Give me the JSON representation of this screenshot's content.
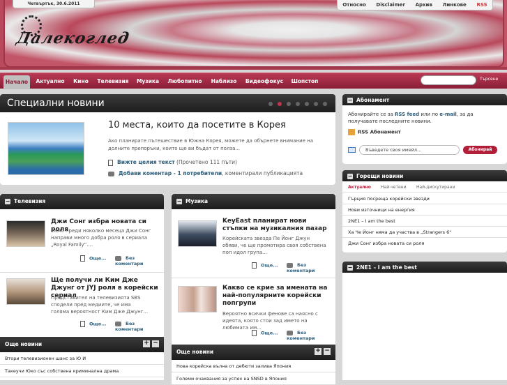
{
  "header": {
    "date": "Четвъртък, 30.6.2011",
    "logo": "Далекоглед",
    "top_links": [
      "Относно",
      "Disclaimer",
      "Архив",
      "Линкове",
      "RSS"
    ]
  },
  "nav": {
    "items": [
      "Начало",
      "Актуално",
      "Кино",
      "Телевизия",
      "Музика",
      "Любопитно",
      "Наблизо",
      "Видеофокус",
      "Шопстоп"
    ],
    "active": "Начало",
    "search_label": "Търсене"
  },
  "special": {
    "title": "Специални новини",
    "article_title": "10 места, които да посетите в Корея",
    "article_text": "Ако планирате пътешествие в Южна Корея, можете да обърнете внимание на долните препоръки, които ще ви бъдат от полза...",
    "read_more": "Вижте целия текст",
    "read_count": "(Прочетено 111 пъти)",
    "comment_add": "Добави коментар - 1 потребители",
    "comment_suffix": ", коментирали публикацията"
  },
  "tv": {
    "title": "Телевизия",
    "articles": [
      {
        "title": "Джи Сонг избра новата си роля",
        "text": "Само преди няколко месеца Джи Сонг направи много добра роля в сериала „Royal Family“....",
        "more": "Още...",
        "comments": "Без коментари"
      },
      {
        "title": "Ще получи ли Ким Дже Джунг от JYJ роля в корейски сериал",
        "text": "Представител на телевизията SBS сподели пред медиите, че има голяма вероятност Ким Дже Джунг...",
        "more": "Още...",
        "comments": "Без коментари"
      }
    ],
    "more_news_title": "Още новини",
    "more_news": [
      "Втори телевизионен шанс за Ю И",
      "Такеучи Юко със собствена криминална драма"
    ]
  },
  "music": {
    "title": "Музика",
    "articles": [
      {
        "title": "KeyEast планират нови стъпки на музикалния пазар",
        "text": "Корейската звезда Пе Йонг Джун обяви, че ще промотира своя собствена поп идол група...",
        "more": "Още...",
        "comments": "Без коментари"
      },
      {
        "title": "Какво се крие за имената на най-популярните корейски попгрупи",
        "text": "Вероятно всички фенове са наясно с идеята, която стои зад името на любимата им...",
        "more": "Още...",
        "comments": "Без коментари"
      }
    ],
    "more_news_title": "Още новини",
    "more_news": [
      "Нова корейска вълна от дебюти залива Япония",
      "Големи очаквания за успех на SNSD в Япония"
    ]
  },
  "subscribe": {
    "title": "Абонамент",
    "text_prefix": "Абонирайте се за ",
    "rss_feed": "RSS feed",
    "text_mid": " или по ",
    "email": "e-mail",
    "text_suffix": ", за да получавате последните новини.",
    "rss_label": "RSS Абонамент",
    "email_placeholder": "Въведете своя имейл...",
    "button": "Абонирай"
  },
  "hot": {
    "title": "Горещи новини",
    "tabs": [
      "Актуално",
      "Най-четени",
      "Най-дискутирани"
    ],
    "items": [
      "Гърция посреща корейски звезди",
      "Нови източници на енергия",
      "2NE1 – I am the best",
      "Ха Че Йонг няма да участва в „Strangers 6“",
      "Джи Сонг избра новата си роля"
    ]
  },
  "video": {
    "title": "2NE1 – I am the best"
  },
  "colors": {
    "accent": "#b21d38",
    "nav": "#8a1d36",
    "link": "#2c5d7a"
  }
}
